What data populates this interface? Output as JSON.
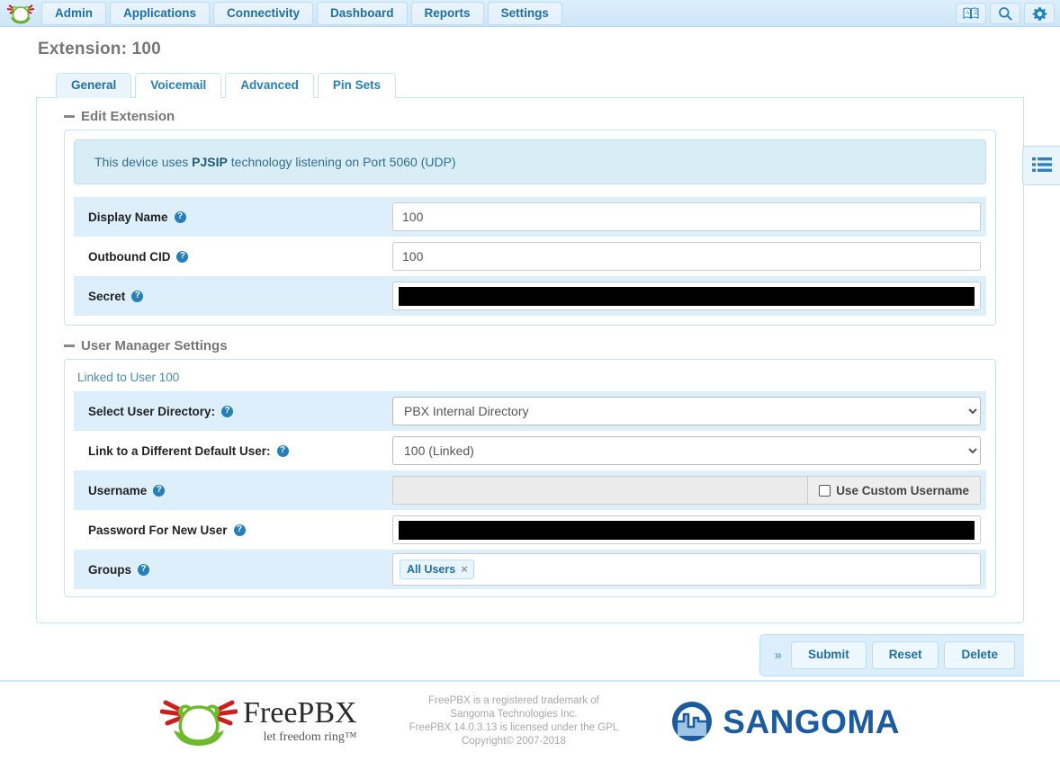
{
  "navbar": {
    "logo_icon": "freepbx-frog-logo",
    "items": [
      {
        "label": "Admin"
      },
      {
        "label": "Applications"
      },
      {
        "label": "Connectivity"
      },
      {
        "label": "Dashboard"
      },
      {
        "label": "Reports"
      },
      {
        "label": "Settings"
      }
    ],
    "right_icons": [
      {
        "name": "language-icon"
      },
      {
        "name": "search-icon"
      },
      {
        "name": "gear-icon"
      }
    ]
  },
  "page": {
    "title": "Extension: 100"
  },
  "tabs": [
    {
      "label": "General",
      "active": true
    },
    {
      "label": "Voicemail",
      "active": false
    },
    {
      "label": "Advanced",
      "active": false
    },
    {
      "label": "Pin Sets",
      "active": false
    }
  ],
  "edit_extension": {
    "section_title": "Edit Extension",
    "info_prefix": "This device uses ",
    "info_bold": "PJSIP",
    "info_suffix": " technology listening on Port 5060 (UDP)",
    "fields": {
      "display_name_label": "Display Name",
      "display_name_value": "100",
      "outbound_cid_label": "Outbound CID",
      "outbound_cid_value": "100",
      "secret_label": "Secret",
      "secret_value": ""
    }
  },
  "user_manager": {
    "section_title": "User Manager Settings",
    "linked_note": "Linked to User 100",
    "select_user_directory_label": "Select User Directory:",
    "select_user_directory_value": "PBX Internal Directory",
    "link_default_user_label": "Link to a Different Default User:",
    "link_default_user_value": "100 (Linked)",
    "username_label": "Username",
    "username_value": "",
    "use_custom_username_label": "Use Custom Username",
    "password_label": "Password For New User",
    "password_value": "",
    "groups_label": "Groups",
    "groups_tags": [
      {
        "label": "All Users",
        "remove": "×"
      }
    ]
  },
  "actions": {
    "expand_chevron": "»",
    "submit_label": "Submit",
    "reset_label": "Reset",
    "delete_label": "Delete"
  },
  "side_tab": {
    "icon": "list-menu-icon"
  },
  "footer": {
    "brand_name": "FreePBX",
    "brand_tagline": "let freedom ring™",
    "legal_line1": "FreePBX is a registered trademark of",
    "legal_line2": "Sangoma Technologies Inc.",
    "legal_line3": "FreePBX 14.0.3.13 is licensed under the GPL",
    "legal_line4": "Copyright© 2007-2018",
    "sangoma_name": "SANGOMA"
  },
  "colors": {
    "nav_bg": "#d6eaf8",
    "accent": "#1f6fa8",
    "link": "#2580b9",
    "row_alt": "#ddeffa",
    "info_bg": "#d9edf7",
    "sangoma_blue": "#1b5b9e"
  }
}
